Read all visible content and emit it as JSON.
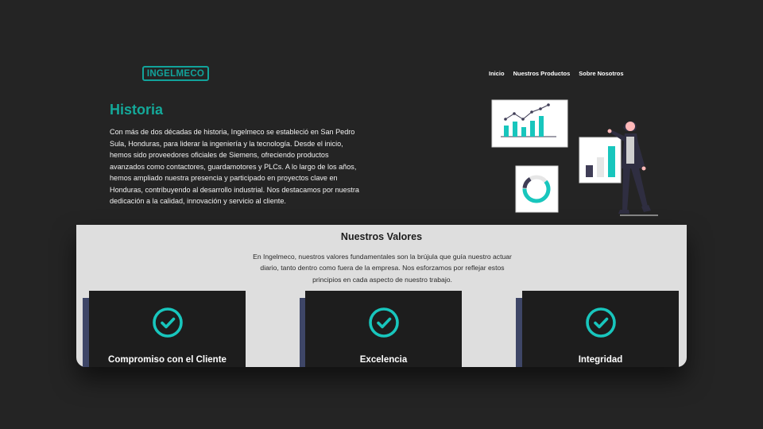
{
  "header": {
    "logo_text": "INGELMECO",
    "nav": [
      "Inicio",
      "Nuestros Productos",
      "Sobre Nosotros"
    ]
  },
  "historia": {
    "title": "Historia",
    "text": "Con más de dos décadas de historia, Ingelmeco se estableció en San Pedro Sula, Honduras, para liderar la ingeniería y la tecnología. Desde el inicio, hemos sido proveedores oficiales de Siemens, ofreciendo productos avanzados como contactores, guardamotores y PLCs. A lo largo de los años, hemos ampliado nuestra presencia y participado en proyectos clave en Honduras, contribuyendo al desarrollo industrial. Nos destacamos por nuestra dedicación a la calidad, innovación y servicio al cliente."
  },
  "valores": {
    "title": "Nuestros Valores",
    "text": "En Ingelmeco, nuestros valores fundamentales son la brújula que guía nuestro actuar diario, tanto dentro como fuera de la empresa. Nos esforzamos por reflejar estos principios en cada aspecto de nuestro trabajo.",
    "cards": [
      {
        "title": "Compromiso con el Cliente",
        "icon": "check-circle-icon"
      },
      {
        "title": "Excelencia",
        "icon": "check-circle-icon"
      },
      {
        "title": "Integridad",
        "icon": "check-circle-icon"
      }
    ]
  },
  "colors": {
    "accent": "#14a99a",
    "background": "#242424",
    "values_bg": "#dedede",
    "card_bg": "#1d1d1d",
    "card_accent": "#3e4667"
  }
}
